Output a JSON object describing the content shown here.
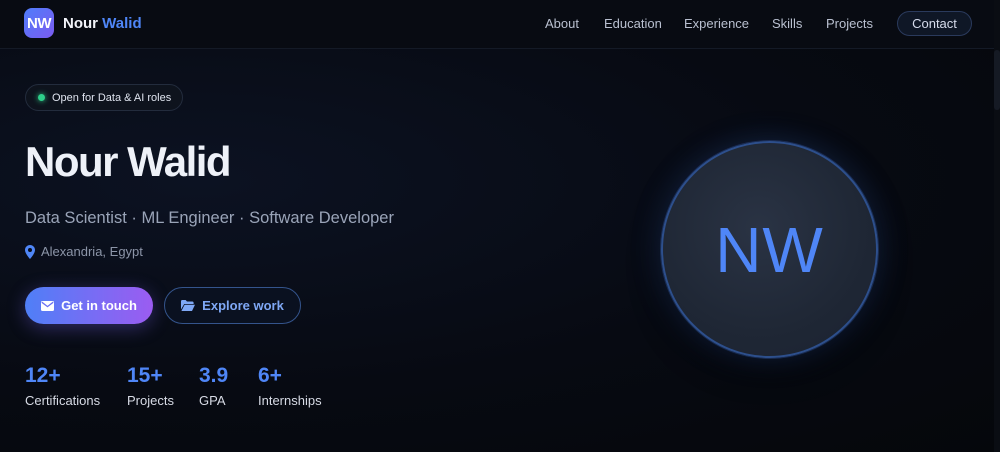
{
  "nav": {
    "logo_initials": "NW",
    "brand_first": "Nour",
    "brand_second": "Walid",
    "links": [
      {
        "label": "About"
      },
      {
        "label": "Education"
      },
      {
        "label": "Experience"
      },
      {
        "label": "Skills"
      },
      {
        "label": "Projects"
      }
    ],
    "contact_label": "Contact"
  },
  "hero": {
    "status": "Open for Data & AI roles",
    "name": "Nour Walid",
    "role": "Data Scientist · ML Engineer · Software Developer",
    "location": "Alexandria, Egypt",
    "primary_button": "Get in touch",
    "secondary_button": "Explore work",
    "avatar_initials": "NW",
    "stats": [
      {
        "value": "12+",
        "label": "Certifications"
      },
      {
        "value": "15+",
        "label": "Projects"
      },
      {
        "value": "3.9",
        "label": "GPA"
      },
      {
        "value": "6+",
        "label": "Internships"
      }
    ]
  },
  "colors": {
    "accent": "#4f86f7",
    "gradient_start": "#4f7ff7",
    "gradient_end": "#9b5cf1",
    "status_green": "#2ecf8a",
    "background": "#06080d"
  },
  "icons": {
    "location": "map-pin-icon",
    "primary_button": "envelope-icon",
    "secondary_button": "folder-open-icon"
  }
}
